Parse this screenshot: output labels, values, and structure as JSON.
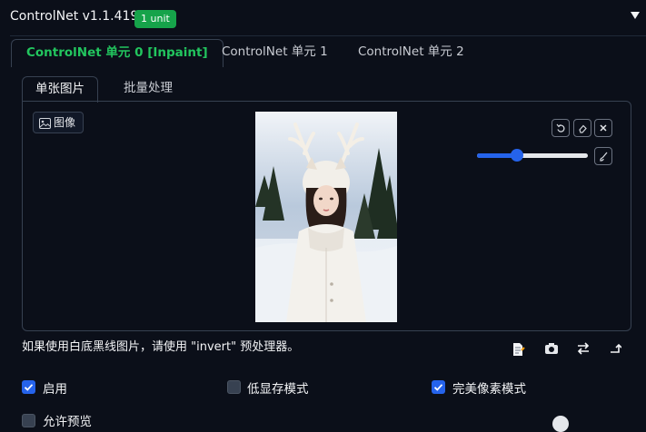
{
  "header": {
    "title": "ControlNet v1.1.419",
    "badge": "1 unit",
    "collapse_icon": "triangle-down-icon"
  },
  "unit_tabs": [
    {
      "label": "ControlNet 单元 0 [Inpaint]",
      "active": true
    },
    {
      "label": "ControlNet 单元 1",
      "active": false
    },
    {
      "label": "ControlNet 单元 2",
      "active": false
    }
  ],
  "sub_tabs": [
    {
      "label": "单张图片",
      "active": true
    },
    {
      "label": "批量处理",
      "active": false
    }
  ],
  "image_input": {
    "label": "图像",
    "image_icon": "image-icon",
    "toolbar_icons": [
      "undo-icon",
      "eraser-icon",
      "close-icon",
      "brush-icon"
    ],
    "brush_size_fraction": 0.33
  },
  "hint": "如果使用白底黑线图片，请使用 \"invert\" 预处理器。",
  "action_icons": [
    "document-icon",
    "camera-icon",
    "swap-icon",
    "send-icon"
  ],
  "options": [
    {
      "label": "启用",
      "checked": true
    },
    {
      "label": "低显存模式",
      "checked": false
    },
    {
      "label": "完美像素模式",
      "checked": true
    },
    {
      "label": "允许预览",
      "checked": false
    }
  ],
  "colors": {
    "background": "#0b0f19",
    "accent_green": "#22c55e",
    "badge_green": "#16a34a",
    "accent_blue": "#2563eb",
    "border": "#374151"
  }
}
